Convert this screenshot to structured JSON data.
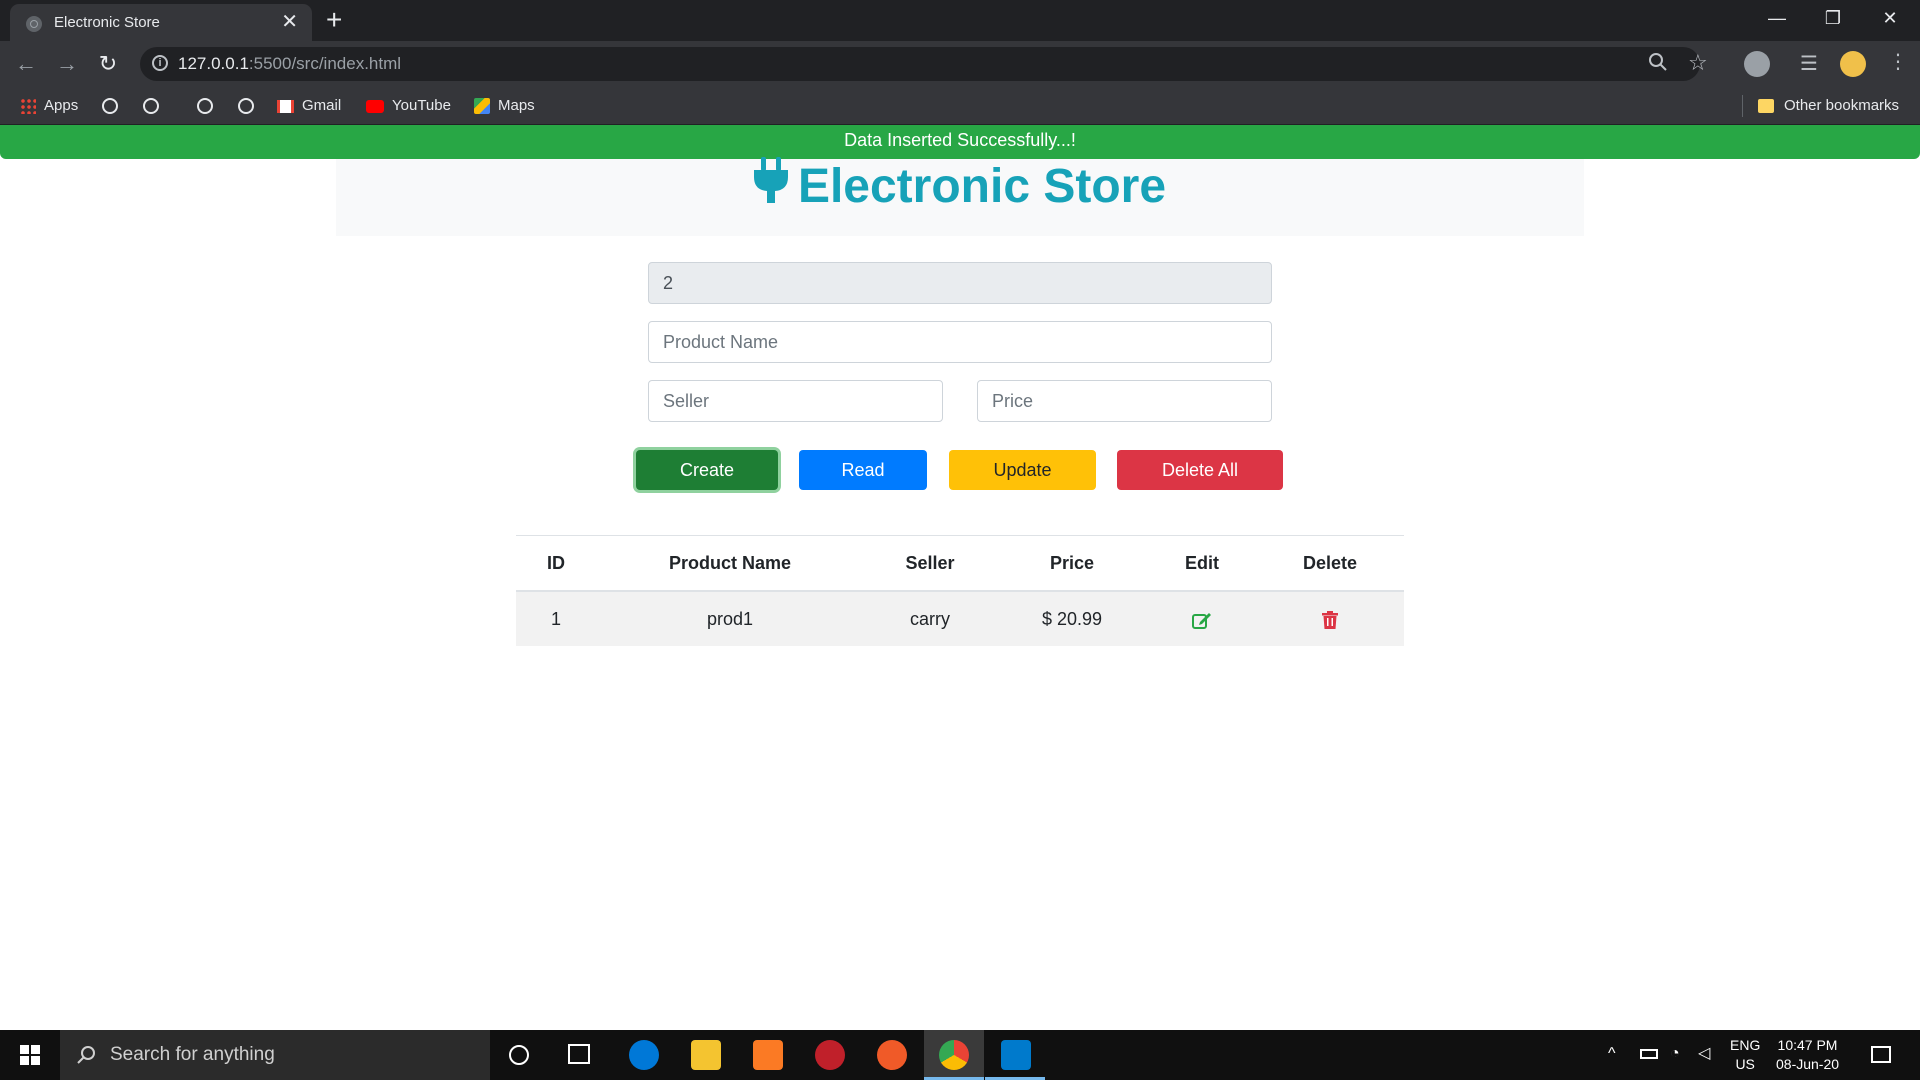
{
  "browser": {
    "tab_title": "Electronic Store",
    "url_host": "127.0.0.1",
    "url_path": ":5500/src/index.html",
    "bookmarks": {
      "apps": "Apps",
      "gmail": "Gmail",
      "youtube": "YouTube",
      "maps": "Maps",
      "other": "Other bookmarks"
    }
  },
  "page": {
    "alert": "Data Inserted Successfully...!",
    "brand": "Electronic Store",
    "form": {
      "id_value": "2",
      "product_placeholder": "Product Name",
      "seller_placeholder": "Seller",
      "price_placeholder": "Price"
    },
    "buttons": {
      "create": "Create",
      "read": "Read",
      "update": "Update",
      "delete_all": "Delete All"
    },
    "table": {
      "headers": [
        "ID",
        "Product Name",
        "Seller",
        "Price",
        "Edit",
        "Delete"
      ],
      "rows": [
        {
          "id": "1",
          "product": "prod1",
          "seller": "carry",
          "price": "$ 20.99"
        }
      ]
    },
    "colors": {
      "success": "#28a745",
      "brand": "#17a2b8",
      "edit_icon": "#28a745",
      "delete_icon": "#dc3545"
    }
  },
  "taskbar": {
    "search_placeholder": "Search for anything",
    "lang": "ENG",
    "region": "US",
    "time": "10:47 PM",
    "date": "08-Jun-20"
  }
}
